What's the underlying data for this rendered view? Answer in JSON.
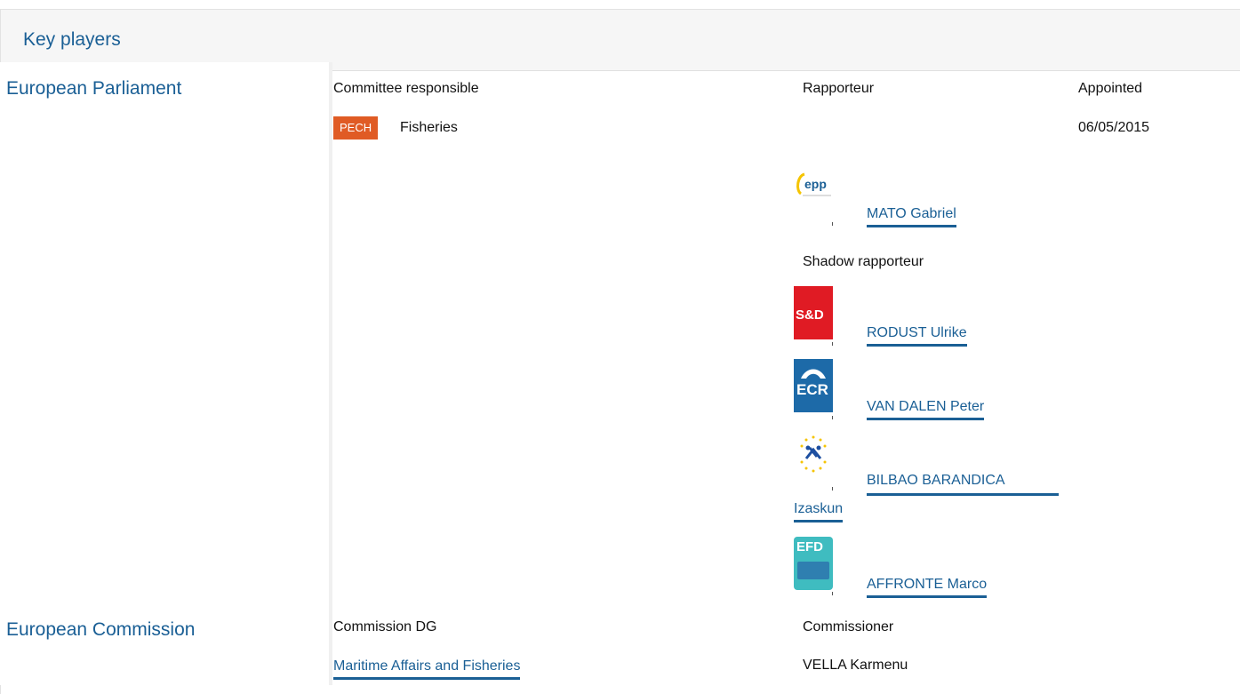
{
  "header": {
    "title": "Key players"
  },
  "parliament": {
    "institution": "European Parliament",
    "committee_header": "Committee responsible",
    "rapporteur_header": "Rapporteur",
    "appointed_header": "Appointed",
    "committee_badge": "PECH",
    "committee_name": "Fisheries",
    "appointed_date": "06/05/2015",
    "rapporteur": {
      "group_logo": "epp-logo",
      "name": "MATO Gabriel"
    },
    "shadow_header": "Shadow rapporteur",
    "shadows": [
      {
        "group_logo": "sd-logo",
        "logo_text": "S&D",
        "name": "RODUST Ulrike"
      },
      {
        "group_logo": "ecr-logo",
        "logo_text": "ECR",
        "name": "VAN DALEN Peter"
      },
      {
        "group_logo": "alde-logo",
        "name_line1": "BILBAO BARANDICA",
        "name_line2": "Izaskun"
      },
      {
        "group_logo": "efdd-logo",
        "logo_text": "EFD",
        "name": "AFFRONTE Marco"
      }
    ]
  },
  "commission": {
    "institution": "European Commission",
    "dg_header": "Commission DG",
    "commissioner_header": "Commissioner",
    "dg_name": "Maritime Affairs and Fisheries",
    "commissioner_name": "VELLA Karmenu"
  },
  "colors": {
    "accent_blue": "#1a5f95",
    "badge_orange": "#e05b24",
    "sd_red": "#e01b24",
    "ecr_blue": "#1d6aa8",
    "efdd_teal": "#3fbcc0"
  }
}
